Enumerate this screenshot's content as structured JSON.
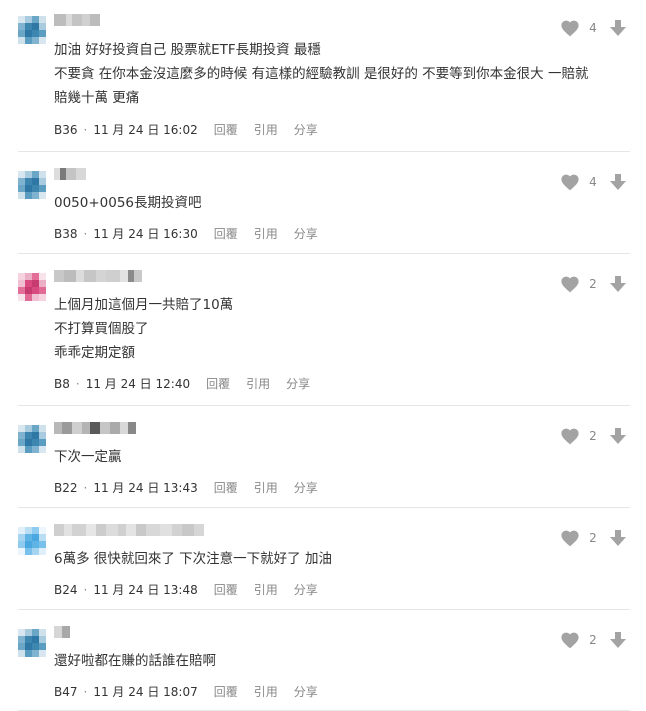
{
  "colors": {
    "text": "#333333",
    "meta": "#888888",
    "icon": "#a3a3a3",
    "divider": "#e6e6e6"
  },
  "actions": {
    "reply_label": "回覆",
    "quote_label": "引用",
    "share_label": "分享"
  },
  "comments": [
    {
      "avatar": "teal",
      "lines": [
        "加油 好好投資自己 股票就ETF長期投資 最穩",
        "不要貪 在你本金沒這麼多的時候 有這樣的經驗教訓 是很好的 不要等到你本金很大 一賠就",
        "賠幾十萬 更痛"
      ],
      "floor": "B36",
      "time": "11 月 24 日 16:02",
      "likes": "4"
    },
    {
      "avatar": "teal",
      "lines": [
        "0050+0056長期投資吧"
      ],
      "floor": "B38",
      "time": "11 月 24 日 16:30",
      "likes": "4"
    },
    {
      "avatar": "pink",
      "lines": [
        "上個月加這個月一共賠了10萬",
        "不打算買個股了",
        "乖乖定期定額"
      ],
      "floor": "B8",
      "time": "11 月 24 日 12:40",
      "likes": "2"
    },
    {
      "avatar": "teal",
      "lines": [
        "下次一定贏"
      ],
      "floor": "B22",
      "time": "11 月 24 日 13:43",
      "likes": "2"
    },
    {
      "avatar": "lightblue",
      "lines": [
        "6萬多 很快就回來了 下次注意一下就好了 加油"
      ],
      "floor": "B24",
      "time": "11 月 24 日 13:48",
      "likes": "2"
    },
    {
      "avatar": "teal",
      "lines": [
        "還好啦都在賺的話誰在賠啊"
      ],
      "floor": "B47",
      "time": "11 月 24 日 18:07",
      "likes": "2"
    }
  ]
}
